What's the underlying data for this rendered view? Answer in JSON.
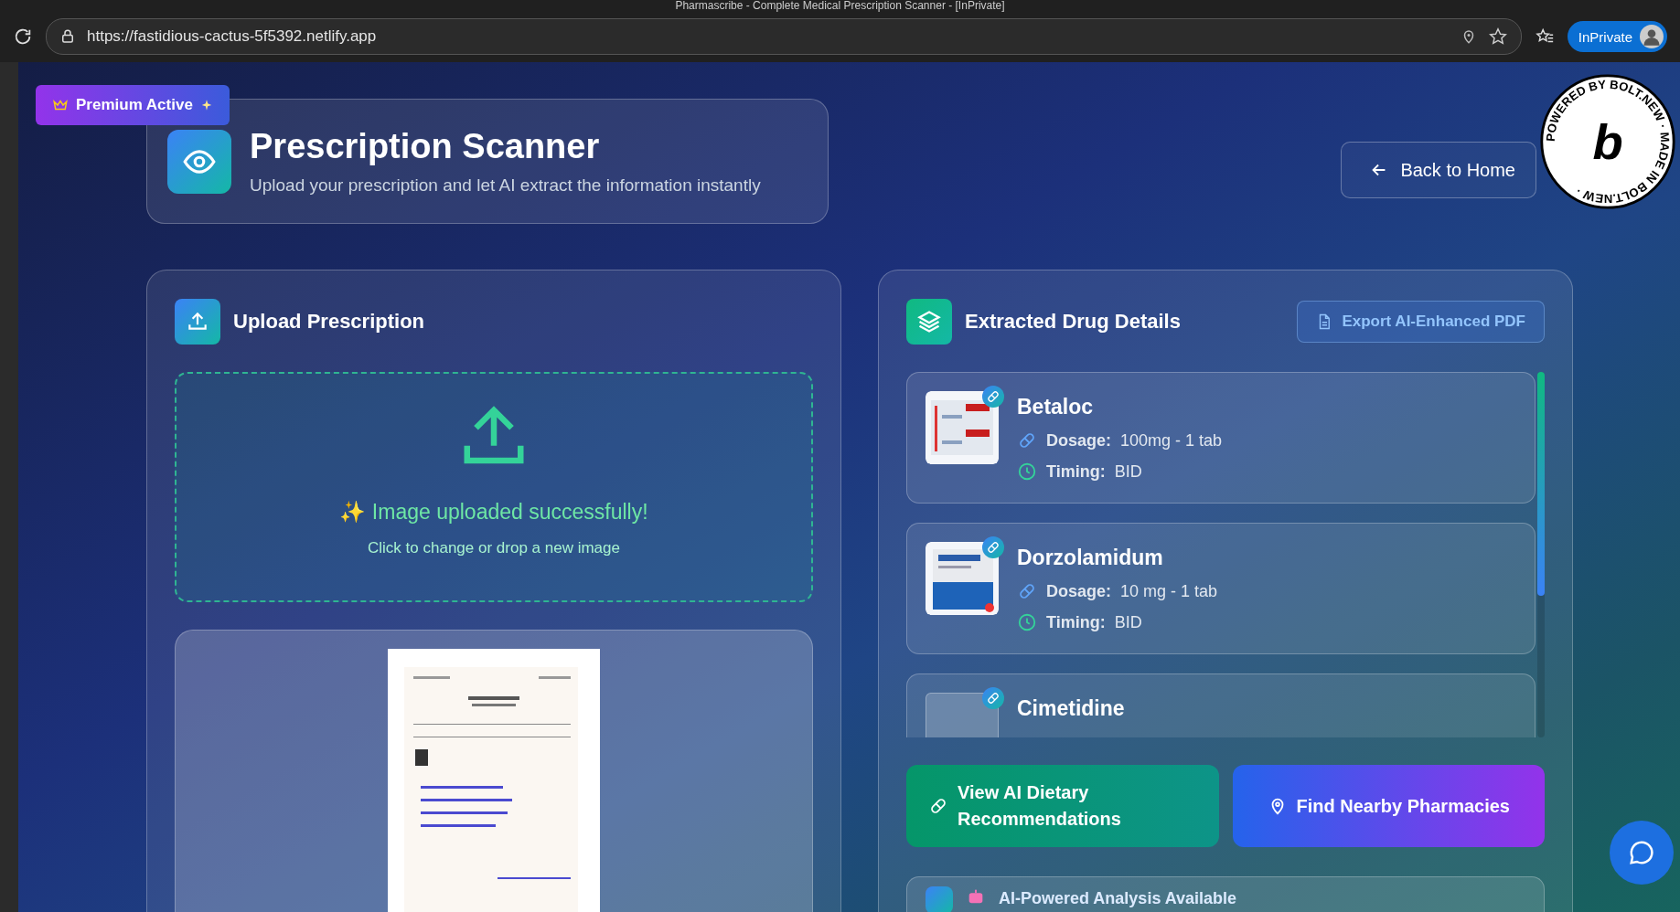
{
  "browser": {
    "title": "Pharmascribe - Complete Medical Prescription Scanner - [InPrivate]",
    "url": "https://fastidious-cactus-5f5392.netlify.app",
    "profile": "InPrivate"
  },
  "badge": {
    "label": "Premium Active"
  },
  "header": {
    "title": "Prescription Scanner",
    "subtitle": "Upload your prescription and let AI extract the information instantly"
  },
  "back_button": "Back to Home",
  "bolt_badge": {
    "ring_text": "POWERED BY BOLT.NEW · MADE IN BOLT.NEW ·",
    "letter": "b"
  },
  "upload": {
    "title": "Upload Prescription",
    "status": "✨ Image uploaded successfully!",
    "hint": "Click to change or drop a new image"
  },
  "results": {
    "title": "Extracted Drug Details",
    "export_button": "Export AI-Enhanced PDF",
    "drugs": [
      {
        "name": "Betaloc",
        "photo": true,
        "dosage_label": "Dosage:",
        "dosage": "100mg - 1 tab",
        "timing_label": "Timing:",
        "timing": "BID"
      },
      {
        "name": "Dorzolamidum",
        "photo": true,
        "dosage_label": "Dosage:",
        "dosage": "10 mg - 1 tab",
        "timing_label": "Timing:",
        "timing": "BID"
      },
      {
        "name": "Cimetidine",
        "photo": false
      }
    ]
  },
  "actions": [
    {
      "label": "View AI Dietary Recommendations",
      "kind": "diet"
    },
    {
      "label": "Find Nearby Pharmacies",
      "kind": "pharmacy"
    }
  ],
  "analysis": {
    "title": "AI-Powered Analysis Available"
  }
}
